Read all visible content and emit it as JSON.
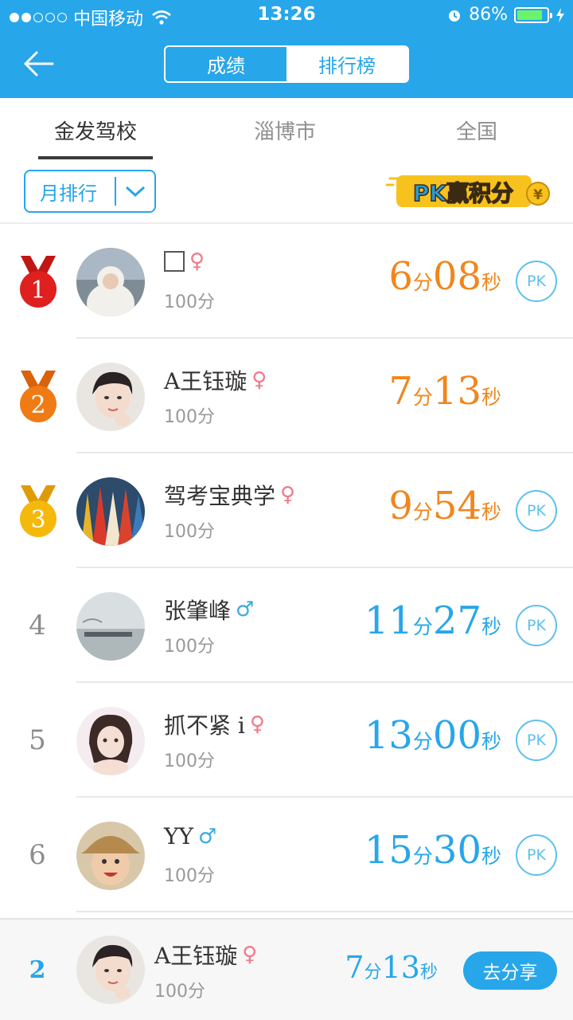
{
  "status_bar": {
    "carrier": "中国移动",
    "time": "13:26",
    "battery": "86%",
    "battery_level": 0.86
  },
  "header": {
    "segments": [
      {
        "label": "成绩",
        "selected": false
      },
      {
        "label": "排行榜",
        "selected": true
      }
    ]
  },
  "tabs": [
    {
      "label": "金发驾校",
      "active": true
    },
    {
      "label": "淄博市",
      "active": false
    },
    {
      "label": "全国",
      "active": false
    }
  ],
  "filter": {
    "label": "月排行"
  },
  "promo": {
    "text": "PK赢积分",
    "coin": "¥"
  },
  "rankings": [
    {
      "rank": "1",
      "medal": "red",
      "name": "",
      "gender": "♀",
      "gender_type": "f",
      "score": "100分",
      "min": "6",
      "min_unit": "分",
      "sec": "08",
      "sec_unit": "秒",
      "color": "orange",
      "pk": "PK",
      "avatar": "woman-in-white-hood"
    },
    {
      "rank": "2",
      "medal": "orange",
      "name": "A王钰璇",
      "gender": "♀",
      "gender_type": "f",
      "score": "100分",
      "min": "7",
      "min_unit": "分",
      "sec": "13",
      "sec_unit": "秒",
      "color": "orange",
      "pk": "",
      "avatar": "woman-selfie"
    },
    {
      "rank": "3",
      "medal": "gold",
      "name": "驾考宝典学",
      "gender": "♀",
      "gender_type": "f",
      "score": "100分",
      "min": "9",
      "min_unit": "分",
      "sec": "54",
      "sec_unit": "秒",
      "color": "orange",
      "pk": "PK",
      "avatar": "colored-pencils"
    },
    {
      "rank": "4",
      "medal": "",
      "name": "张肇峰",
      "gender": "♂",
      "gender_type": "m",
      "score": "100分",
      "min": "11",
      "min_unit": "分",
      "sec": "27",
      "sec_unit": "秒",
      "color": "blue",
      "pk": "PK",
      "avatar": "misty-harbor"
    },
    {
      "rank": "5",
      "medal": "",
      "name": "抓不紧 i",
      "gender": "♀",
      "gender_type": "f",
      "score": "100分",
      "min": "13",
      "min_unit": "分",
      "sec": "00",
      "sec_unit": "秒",
      "color": "blue",
      "pk": "PK",
      "avatar": "woman-heart-hands"
    },
    {
      "rank": "6",
      "medal": "",
      "name": "YY",
      "gender": "♂",
      "gender_type": "m",
      "score": "100分",
      "min": "15",
      "min_unit": "分",
      "sec": "30",
      "sec_unit": "秒",
      "color": "blue",
      "pk": "PK",
      "avatar": "baby-in-hat"
    }
  ],
  "my_rank": {
    "rank": "2",
    "name": "A王钰璇",
    "gender": "♀",
    "score": "100分",
    "min": "7",
    "min_unit": "分",
    "sec": "13",
    "sec_unit": "秒",
    "share_label": "去分享",
    "avatar": "woman-selfie"
  },
  "colors": {
    "brand": "#27a6ea",
    "orange_time": "#f0861d",
    "female": "#f0798b",
    "male": "#3aa9e5"
  }
}
